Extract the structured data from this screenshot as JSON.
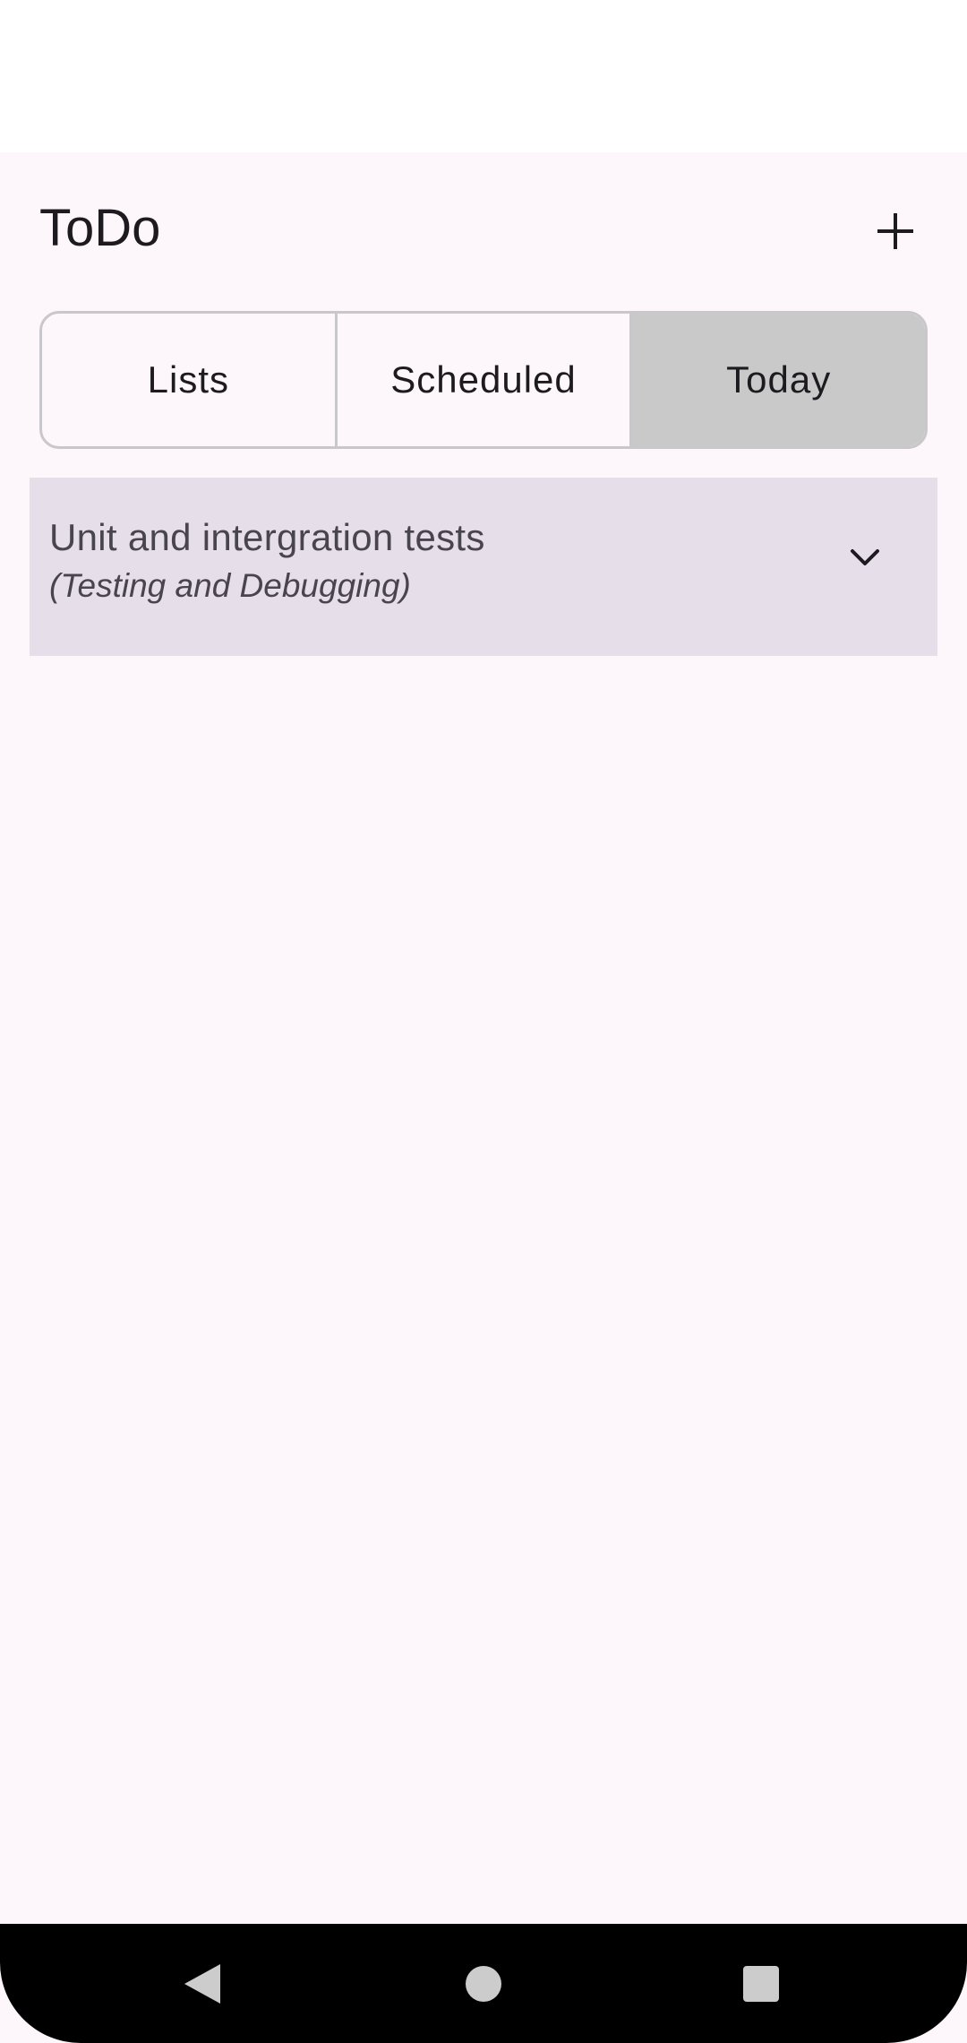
{
  "app": {
    "title": "ToDo"
  },
  "header": {
    "add_icon": "plus-icon"
  },
  "tabs": [
    {
      "label": "Lists",
      "selected": false
    },
    {
      "label": "Scheduled",
      "selected": false
    },
    {
      "label": "Today",
      "selected": true
    }
  ],
  "list_item": {
    "title": "Unit and intergration tests",
    "subtitle": "(Testing and Debugging)",
    "expand_icon": "chevron-down-icon"
  },
  "nav": {
    "back_icon": "back-triangle-icon",
    "home_icon": "home-circle-icon",
    "recents_icon": "recents-square-icon"
  },
  "colors": {
    "background": "#fdf7fc",
    "selected_tab": "#c9c9c9",
    "card": "#e6dfea",
    "text_primary": "#1d1b20",
    "text_secondary": "#49454f",
    "nav_bar": "#000000"
  }
}
